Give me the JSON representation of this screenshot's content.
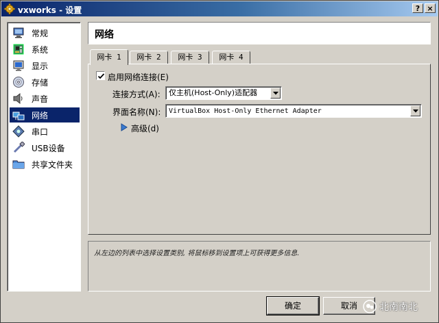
{
  "window": {
    "title": "vxworks - 设置",
    "help_label": "?",
    "close_label": "×"
  },
  "sidebar": {
    "items": [
      {
        "label": "常规",
        "icon": "monitor-icon"
      },
      {
        "label": "系统",
        "icon": "motherboard-icon"
      },
      {
        "label": "显示",
        "icon": "display-icon"
      },
      {
        "label": "存储",
        "icon": "disc-icon"
      },
      {
        "label": "声音",
        "icon": "speaker-icon"
      },
      {
        "label": "网络",
        "icon": "network-icon",
        "selected": true
      },
      {
        "label": "串口",
        "icon": "serial-port-icon"
      },
      {
        "label": "USB设备",
        "icon": "usb-icon"
      },
      {
        "label": "共享文件夹",
        "icon": "folder-icon"
      }
    ]
  },
  "page": {
    "title": "网络"
  },
  "tabs": [
    "网卡 1",
    "网卡 2",
    "网卡 3",
    "网卡 4"
  ],
  "adapter": {
    "enable_label": "启用网络连接(E)",
    "enabled": true,
    "attach_label": "连接方式(A):",
    "attach_value": "仅主机(Host-Only)适配器",
    "name_label": "界面名称(N):",
    "name_value": "VirtualBox Host-Only Ethernet Adapter",
    "advanced_label": "高级(d)"
  },
  "info": {
    "text": "从左边的列表中选择设置类别, 将鼠标移到设置项上可获得更多信息."
  },
  "buttons": {
    "ok": "确定",
    "cancel": "取消"
  },
  "watermark": {
    "text": "北南南北"
  },
  "colors": {
    "title_start": "#0a246a",
    "title_end": "#a6caf0",
    "selection": "#0a246a",
    "face": "#d4d0c8"
  }
}
